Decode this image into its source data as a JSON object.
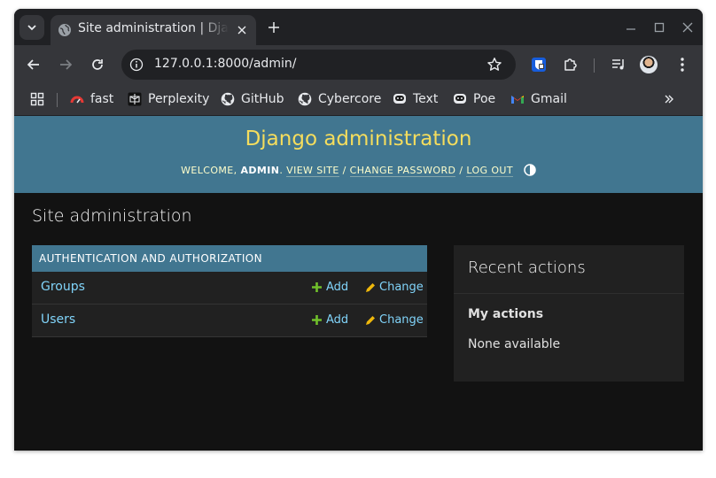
{
  "browser": {
    "tab_title": "Site administration | Django site admin",
    "url": "127.0.0.1:8000/admin/",
    "bookmarks": [
      {
        "label": "fast",
        "icon": "gauge-icon"
      },
      {
        "label": "Perplexity",
        "icon": "perplexity-icon"
      },
      {
        "label": "GitHub",
        "icon": "github-icon"
      },
      {
        "label": "Cybercore",
        "icon": "github-icon"
      },
      {
        "label": "Text",
        "icon": "poe-icon"
      },
      {
        "label": "Poe",
        "icon": "poe-icon"
      },
      {
        "label": "Gmail",
        "icon": "gmail-icon"
      }
    ]
  },
  "header": {
    "title": "Django administration",
    "welcome": "WELCOME,",
    "user": "ADMIN",
    "view_site": "VIEW SITE",
    "change_password": "CHANGE PASSWORD",
    "log_out": "LOG OUT",
    "sep": "/"
  },
  "main": {
    "page_title": "Site administration",
    "app": {
      "caption": "AUTHENTICATION AND AUTHORIZATION",
      "models": [
        {
          "name": "Groups",
          "add": "Add",
          "change": "Change"
        },
        {
          "name": "Users",
          "add": "Add",
          "change": "Change"
        }
      ]
    }
  },
  "recent_actions": {
    "title": "Recent actions",
    "subtitle": "My actions",
    "empty": "None available"
  },
  "colors": {
    "header_bg": "#417690",
    "branding": "#f5dd5d",
    "link": "#81d4fa",
    "add_icon": "#70bf2b",
    "change_icon": "#efb80b"
  }
}
